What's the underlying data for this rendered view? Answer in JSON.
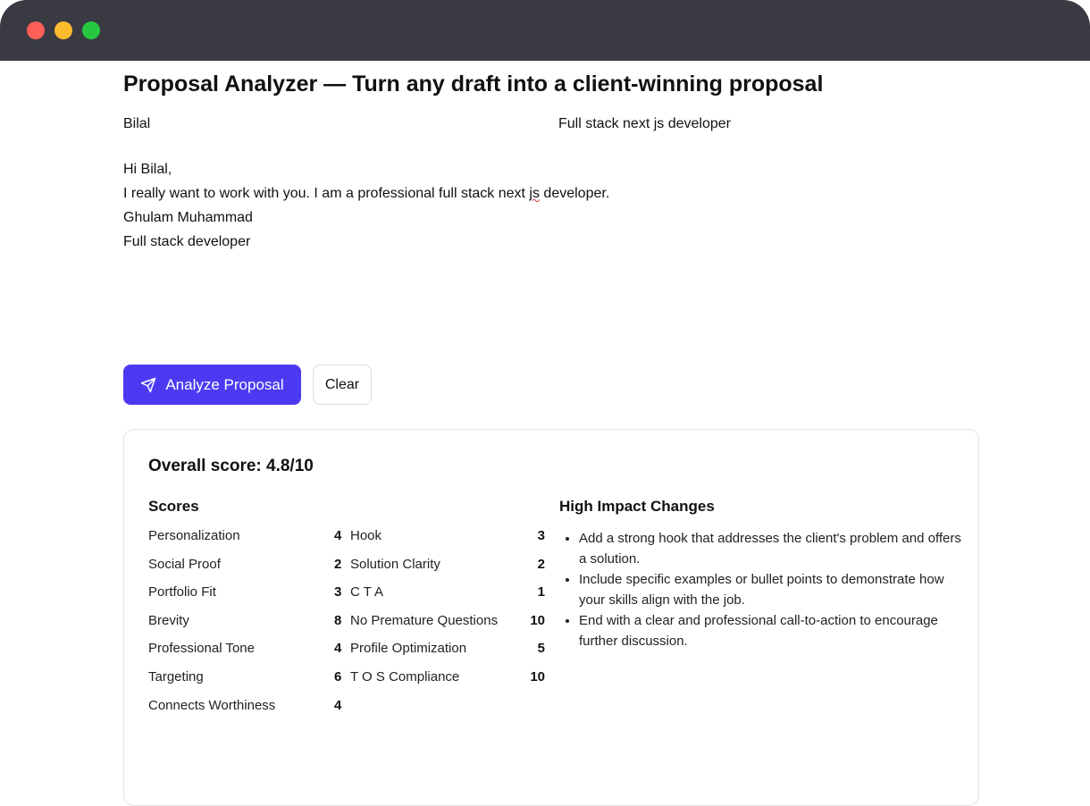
{
  "window": {
    "traffic_lights": [
      "#fe5f57",
      "#fdbc2e",
      "#27c840"
    ]
  },
  "header": {
    "title": "Proposal Analyzer — Turn any draft into a client-winning proposal"
  },
  "form": {
    "client_name": "Bilal",
    "job_title": "Full stack next js developer",
    "proposal_lines": [
      "Hi Bilal,",
      "I really want to work with you. I am a professional full stack next js developer.",
      "Ghulam Muhammad",
      "Full stack developer"
    ]
  },
  "actions": {
    "analyze_label": "Analyze Proposal",
    "analyze_icon": "send-icon",
    "clear_label": "Clear",
    "accent_color": "#4c3af2"
  },
  "results": {
    "overall": "Overall score: 4.8/10",
    "scores_title": "Scores",
    "scores_left": [
      {
        "label": "Personalization",
        "value": "4"
      },
      {
        "label": "Social Proof",
        "value": "2"
      },
      {
        "label": "Portfolio Fit",
        "value": "3"
      },
      {
        "label": "Brevity",
        "value": "8"
      },
      {
        "label": "Professional Tone",
        "value": "4"
      },
      {
        "label": "Targeting",
        "value": "6"
      },
      {
        "label": "Connects Worthiness",
        "value": "4"
      }
    ],
    "scores_right": [
      {
        "label": "Hook",
        "value": "3"
      },
      {
        "label": "Solution Clarity",
        "value": "2"
      },
      {
        "label": "C T A",
        "value": "1"
      },
      {
        "label": "No Premature Questions",
        "value": "10"
      },
      {
        "label": "Profile Optimization",
        "value": "5"
      },
      {
        "label": "T O S Compliance",
        "value": "10"
      }
    ],
    "changes_title": "High Impact Changes",
    "changes": [
      "Add a strong hook that addresses the client's problem and offers a solution.",
      "Include specific examples or bullet points to demonstrate how your skills align with the job.",
      "End with a clear and professional call-to-action to encourage further discussion."
    ]
  }
}
